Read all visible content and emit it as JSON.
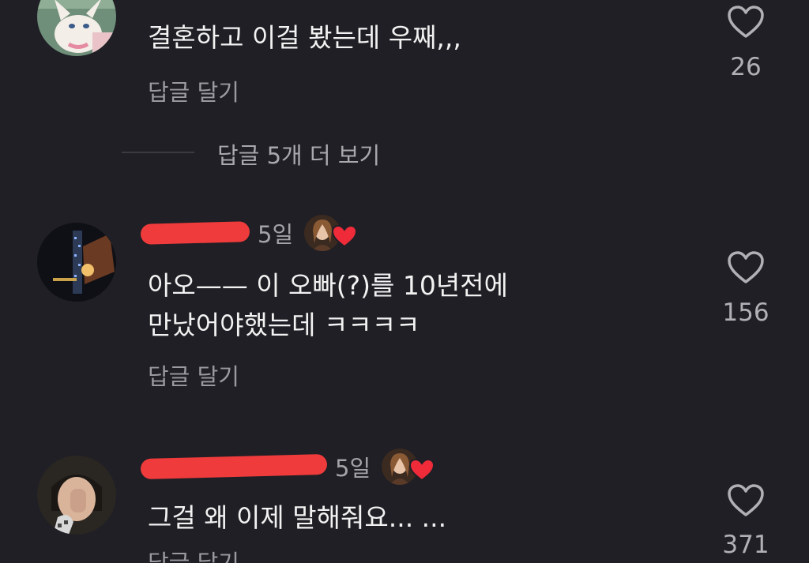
{
  "comments": [
    {
      "text": "결혼하고 이걸 봤는데 우째,,,",
      "reply_label": "답글 달기",
      "like_count": "26"
    },
    {
      "time": "5일",
      "text_line1": "아오—— 이 오빠(?)를 10년전에",
      "text_line2": "만났어야했는데 ㅋㅋㅋㅋ",
      "reply_label": "답글 달기",
      "like_count": "156"
    },
    {
      "time": "5일",
      "text": "그걸 왜 이제 말해줘요... ...",
      "reply_label": "답글 달기",
      "like_count": "371"
    }
  ],
  "view_more_replies": "답글 5개 더 보기",
  "colors": {
    "background": "#1f1f25",
    "text": "#f2f2f2",
    "muted": "#9a9aa0",
    "heart": "#ef2b3a",
    "redaction": "#ef3b3b"
  }
}
